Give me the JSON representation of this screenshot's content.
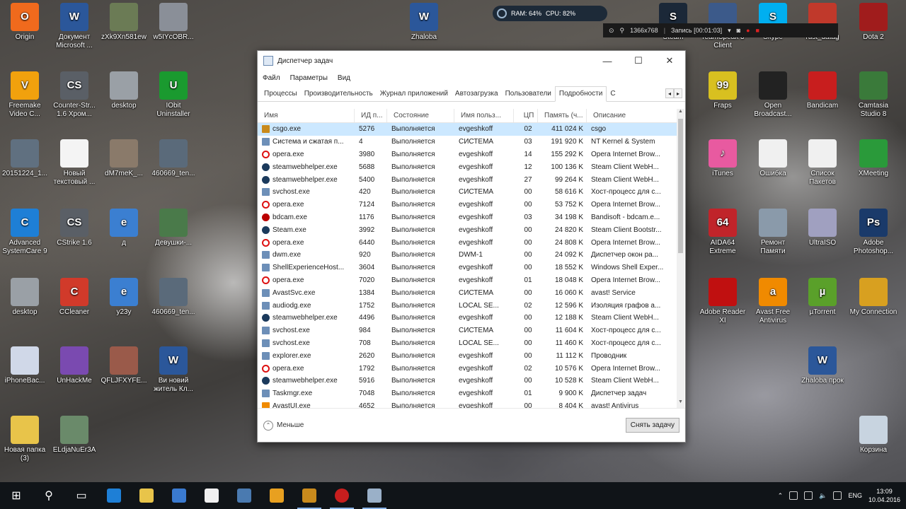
{
  "desktop": {
    "icons_left": [
      {
        "label": "Origin",
        "color": "#f06a1d",
        "glyph": "O"
      },
      {
        "label": "Документ Microsoft ...",
        "color": "#2b579a",
        "glyph": "W"
      },
      {
        "label": "zXk9Xn581ew",
        "color": "#6b7b55",
        "glyph": ""
      },
      {
        "label": "w5IYcOBR...",
        "color": "#8a8f98",
        "glyph": ""
      },
      {
        "label": "Freemake Video C...",
        "color": "#f1a10d",
        "glyph": "V"
      },
      {
        "label": "Counter-Str... 1.6 Хром...",
        "color": "#5a5f66",
        "glyph": "CS"
      },
      {
        "label": "desktop",
        "color": "#9aa0a6",
        "glyph": ""
      },
      {
        "label": "IObit Uninstaller",
        "color": "#1a9a2f",
        "glyph": "U"
      },
      {
        "label": "20151224_1...",
        "color": "#607080",
        "glyph": ""
      },
      {
        "label": "Новый текстовый ...",
        "color": "#f4f4f4",
        "glyph": ""
      },
      {
        "label": "dM7meK_...",
        "color": "#8a7a6a",
        "glyph": ""
      },
      {
        "label": "460669_ten...",
        "color": "#5a6a7a",
        "glyph": ""
      },
      {
        "label": "Advanced SystemCare 9",
        "color": "#1e7fd6",
        "glyph": "C"
      },
      {
        "label": "CStrike 1.6",
        "color": "#5a5f66",
        "glyph": "CS"
      },
      {
        "label": "д",
        "color": "#3b7fd1",
        "glyph": "e"
      },
      {
        "label": "Девушки-...",
        "color": "#4a7a4a",
        "glyph": ""
      },
      {
        "label": "desktop",
        "color": "#9aa0a6",
        "glyph": ""
      },
      {
        "label": "CCleaner",
        "color": "#d13a2a",
        "glyph": "C"
      },
      {
        "label": "y23y",
        "color": "#3b7fd1",
        "glyph": "e"
      },
      {
        "label": "460669_ten...",
        "color": "#5a6a7a",
        "glyph": ""
      },
      {
        "label": "iPhoneBac...",
        "color": "#d0d8e8",
        "glyph": ""
      },
      {
        "label": "UnHackMe",
        "color": "#7a4ab0",
        "glyph": ""
      },
      {
        "label": "QFLJFXYFE...",
        "color": "#9a5a4a",
        "glyph": ""
      },
      {
        "label": "Ви новий житель Кл...",
        "color": "#2b579a",
        "glyph": "W"
      },
      {
        "label": "Новая папка (3)",
        "color": "#e8c44a",
        "glyph": ""
      },
      {
        "label": "ELdjaNuEr3A",
        "color": "#6a8a6a",
        "glyph": ""
      }
    ],
    "icons_right": [
      {
        "label": "Zhaloba",
        "color": "#2b579a",
        "glyph": "W"
      },
      {
        "label": "Steam",
        "color": "#1b2838",
        "glyph": "S"
      },
      {
        "label": "TeamSpeak 3 Client",
        "color": "#3c5a8a",
        "glyph": ""
      },
      {
        "label": "Skype",
        "color": "#00aff0",
        "glyph": "S"
      },
      {
        "label": "rust_datag",
        "color": "#c0392b",
        "glyph": ""
      },
      {
        "label": "Dota 2",
        "color": "#a01c1c",
        "glyph": ""
      },
      {
        "label": "Fraps",
        "color": "#d8c020",
        "glyph": "99"
      },
      {
        "label": "Open Broadcast...",
        "color": "#222",
        "glyph": ""
      },
      {
        "label": "Bandicam",
        "color": "#c81e1e",
        "glyph": ""
      },
      {
        "label": "Camtasia Studio 8",
        "color": "#3a7a3a",
        "glyph": ""
      },
      {
        "label": "iTunes",
        "color": "#e85aa0",
        "glyph": "♪"
      },
      {
        "label": "Ошибка",
        "color": "#f0f0f0",
        "glyph": ""
      },
      {
        "label": "Список Пакетов",
        "color": "#f0f0f0",
        "glyph": ""
      },
      {
        "label": "XMeeting",
        "color": "#2a9a3a",
        "glyph": ""
      },
      {
        "label": "AIDA64 Extreme",
        "color": "#c0242a",
        "glyph": "64"
      },
      {
        "label": "Ремонт Памяти",
        "color": "#8a9aaa",
        "glyph": ""
      },
      {
        "label": "UltraISO",
        "color": "#a0a0c0",
        "glyph": ""
      },
      {
        "label": "Adobe Photoshop...",
        "color": "#1a3a6a",
        "glyph": "Ps"
      },
      {
        "label": "Adobe Reader XI",
        "color": "#c01010",
        "glyph": ""
      },
      {
        "label": "Avast Free Antivirus",
        "color": "#f08a00",
        "glyph": "a"
      },
      {
        "label": "µTorrent",
        "color": "#5aa02a",
        "glyph": "µ"
      },
      {
        "label": "My Connection",
        "color": "#d8a020",
        "glyph": ""
      },
      {
        "label": "Zhaloba прок",
        "color": "#2b579a",
        "glyph": "W"
      },
      {
        "label": "Корзина",
        "color": "#c8d4e0",
        "glyph": ""
      }
    ]
  },
  "overlay": {
    "ram": "RAM: 64%",
    "cpu": "CPU: 82%",
    "resolution": "1366x768",
    "record": "Запись [00:01:03]"
  },
  "taskmanager": {
    "title": "Диспетчер задач",
    "menu": [
      "Файл",
      "Параметры",
      "Вид"
    ],
    "tabs": [
      "Процессы",
      "Производительность",
      "Журнал приложений",
      "Автозагрузка",
      "Пользователи",
      "Подробности",
      "С"
    ],
    "active_tab": 5,
    "columns": {
      "name": "Имя",
      "pid": "ИД п...",
      "state": "Состояние",
      "user": "Имя польз...",
      "cpu": "ЦП",
      "mem": "Память (ч...",
      "desc": "Описание"
    },
    "rows": [
      {
        "name": "csgo.exe",
        "pid": "5276",
        "state": "Выполняется",
        "user": "evgeshkoff",
        "cpu": "02",
        "mem": "411 024 K",
        "desc": "csgo",
        "icon": "cs",
        "selected": true
      },
      {
        "name": "Система и сжатая п...",
        "pid": "4",
        "state": "Выполняется",
        "user": "СИСТЕМА",
        "cpu": "03",
        "mem": "191 920 K",
        "desc": "NT Kernel & System",
        "icon": "win"
      },
      {
        "name": "opera.exe",
        "pid": "3980",
        "state": "Выполняется",
        "user": "evgeshkoff",
        "cpu": "14",
        "mem": "155 292 K",
        "desc": "Opera Internet Brow...",
        "icon": "opera"
      },
      {
        "name": "steamwebhelper.exe",
        "pid": "5688",
        "state": "Выполняется",
        "user": "evgeshkoff",
        "cpu": "12",
        "mem": "100 136 K",
        "desc": "Steam Client WebH...",
        "icon": "steam"
      },
      {
        "name": "steamwebhelper.exe",
        "pid": "5400",
        "state": "Выполняется",
        "user": "evgeshkoff",
        "cpu": "27",
        "mem": "99 264 K",
        "desc": "Steam Client WebH...",
        "icon": "steam"
      },
      {
        "name": "svchost.exe",
        "pid": "420",
        "state": "Выполняется",
        "user": "СИСТЕМА",
        "cpu": "00",
        "mem": "58 616 K",
        "desc": "Хост-процесс для с...",
        "icon": "win"
      },
      {
        "name": "opera.exe",
        "pid": "7124",
        "state": "Выполняется",
        "user": "evgeshkoff",
        "cpu": "00",
        "mem": "53 752 K",
        "desc": "Opera Internet Brow...",
        "icon": "opera"
      },
      {
        "name": "bdcam.exe",
        "pid": "1176",
        "state": "Выполняется",
        "user": "evgeshkoff",
        "cpu": "03",
        "mem": "34 198 K",
        "desc": "Bandisoft - bdcam.e...",
        "icon": "bd"
      },
      {
        "name": "Steam.exe",
        "pid": "3992",
        "state": "Выполняется",
        "user": "evgeshkoff",
        "cpu": "00",
        "mem": "24 820 K",
        "desc": "Steam Client Bootstr...",
        "icon": "steam"
      },
      {
        "name": "opera.exe",
        "pid": "6440",
        "state": "Выполняется",
        "user": "evgeshkoff",
        "cpu": "00",
        "mem": "24 808 K",
        "desc": "Opera Internet Brow...",
        "icon": "opera"
      },
      {
        "name": "dwm.exe",
        "pid": "920",
        "state": "Выполняется",
        "user": "DWM-1",
        "cpu": "00",
        "mem": "24 092 K",
        "desc": "Диспетчер окон ра...",
        "icon": "win"
      },
      {
        "name": "ShellExperienceHost...",
        "pid": "3604",
        "state": "Выполняется",
        "user": "evgeshkoff",
        "cpu": "00",
        "mem": "18 552 K",
        "desc": "Windows Shell Exper...",
        "icon": "win"
      },
      {
        "name": "opera.exe",
        "pid": "7020",
        "state": "Выполняется",
        "user": "evgeshkoff",
        "cpu": "01",
        "mem": "18 048 K",
        "desc": "Opera Internet Brow...",
        "icon": "opera"
      },
      {
        "name": "AvastSvc.exe",
        "pid": "1384",
        "state": "Выполняется",
        "user": "СИСТЕМА",
        "cpu": "00",
        "mem": "16 060 K",
        "desc": "avast! Service",
        "icon": "win"
      },
      {
        "name": "audiodg.exe",
        "pid": "1752",
        "state": "Выполняется",
        "user": "LOCAL SE...",
        "cpu": "02",
        "mem": "12 596 K",
        "desc": "Изоляция графов а...",
        "icon": "win"
      },
      {
        "name": "steamwebhelper.exe",
        "pid": "4496",
        "state": "Выполняется",
        "user": "evgeshkoff",
        "cpu": "00",
        "mem": "12 188 K",
        "desc": "Steam Client WebH...",
        "icon": "steam"
      },
      {
        "name": "svchost.exe",
        "pid": "984",
        "state": "Выполняется",
        "user": "СИСТЕМА",
        "cpu": "00",
        "mem": "11 604 K",
        "desc": "Хост-процесс для с...",
        "icon": "win"
      },
      {
        "name": "svchost.exe",
        "pid": "708",
        "state": "Выполняется",
        "user": "LOCAL SE...",
        "cpu": "00",
        "mem": "11 460 K",
        "desc": "Хост-процесс для с...",
        "icon": "win"
      },
      {
        "name": "explorer.exe",
        "pid": "2620",
        "state": "Выполняется",
        "user": "evgeshkoff",
        "cpu": "00",
        "mem": "11 112 K",
        "desc": "Проводник",
        "icon": "win"
      },
      {
        "name": "opera.exe",
        "pid": "1792",
        "state": "Выполняется",
        "user": "evgeshkoff",
        "cpu": "02",
        "mem": "10 576 K",
        "desc": "Opera Internet Brow...",
        "icon": "opera"
      },
      {
        "name": "steamwebhelper.exe",
        "pid": "5916",
        "state": "Выполняется",
        "user": "evgeshkoff",
        "cpu": "00",
        "mem": "10 528 K",
        "desc": "Steam Client WebH...",
        "icon": "steam"
      },
      {
        "name": "Taskmgr.exe",
        "pid": "7048",
        "state": "Выполняется",
        "user": "evgeshkoff",
        "cpu": "01",
        "mem": "9 900 K",
        "desc": "Диспетчер задач",
        "icon": "win"
      },
      {
        "name": "AvastUI.exe",
        "pid": "4652",
        "state": "Выполняется",
        "user": "evgeshkoff",
        "cpu": "00",
        "mem": "8 404 K",
        "desc": "avast! Antivirus",
        "icon": "av"
      }
    ],
    "footer": {
      "less_label": "Меньше",
      "end_task_label": "Снять задачу"
    }
  },
  "taskbar": {
    "apps": [
      {
        "name": "edge",
        "color": "#1e7fd6"
      },
      {
        "name": "file-explorer",
        "color": "#e8c44a"
      },
      {
        "name": "store",
        "color": "#3a7ad0"
      },
      {
        "name": "notepad",
        "color": "#f0f0f0"
      },
      {
        "name": "network-tool",
        "color": "#4a7ab0"
      },
      {
        "name": "media-player",
        "color": "#e8a020"
      },
      {
        "name": "csgo",
        "color": "#c98a1c"
      },
      {
        "name": "bandicam",
        "color": "#c81e1e"
      },
      {
        "name": "task-manager",
        "color": "#9ab0c8"
      }
    ],
    "language": "ENG",
    "time": "13:09",
    "date": "10.04.2016"
  }
}
